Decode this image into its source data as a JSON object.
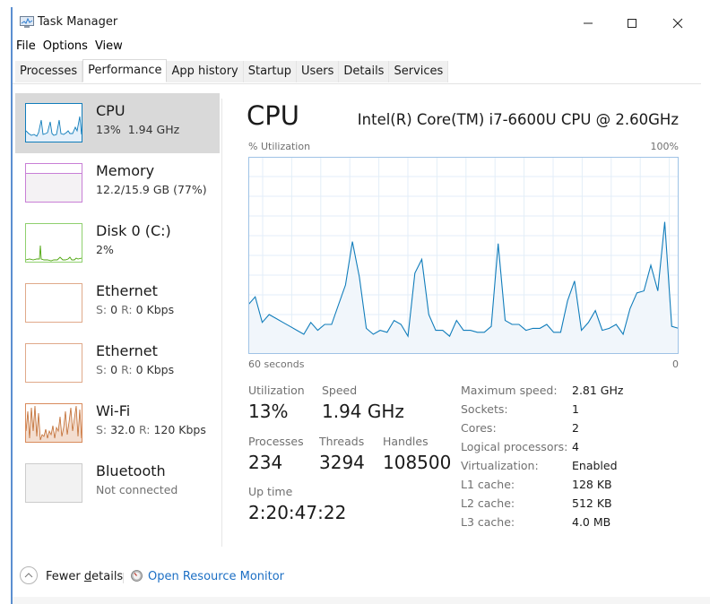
{
  "window": {
    "title": "Task Manager",
    "controls": {
      "minimize": "minimize-icon",
      "maximize": "maximize-icon",
      "close": "close-icon"
    }
  },
  "menu": [
    "File",
    "Options",
    "View"
  ],
  "tabs": [
    {
      "label": "Processes",
      "active": false
    },
    {
      "label": "Performance",
      "active": true
    },
    {
      "label": "App history",
      "active": false
    },
    {
      "label": "Startup",
      "active": false
    },
    {
      "label": "Users",
      "active": false
    },
    {
      "label": "Details",
      "active": false
    },
    {
      "label": "Services",
      "active": false
    }
  ],
  "sidebar": [
    {
      "name": "CPU",
      "sub": "13%  1.94 GHz",
      "color": "#117dbb",
      "selected": true
    },
    {
      "name": "Memory",
      "sub": "12.2/15.9 GB (77%)",
      "color": "#8b12ae",
      "selected": false
    },
    {
      "name": "Disk 0 (C:)",
      "sub": "2%",
      "color": "#4da60c",
      "selected": false
    },
    {
      "name": "Ethernet",
      "sub_s": "S:",
      "sub_s_val": "0",
      "sub_r": "R:",
      "sub_r_val": "0 Kbps",
      "color": "#a74f01",
      "selected": false
    },
    {
      "name": "Ethernet",
      "sub_s": "S:",
      "sub_s_val": "0",
      "sub_r": "R:",
      "sub_r_val": "0 Kbps",
      "color": "#a74f01",
      "selected": false
    },
    {
      "name": "Wi-Fi",
      "sub_s": "S:",
      "sub_s_val": "32.0",
      "sub_r": "R:",
      "sub_r_val": "120 Kbps",
      "color": "#a74f01",
      "selected": false
    },
    {
      "name": "Bluetooth",
      "sub": "Not connected",
      "color": "#999999",
      "selected": false
    }
  ],
  "main": {
    "title": "CPU",
    "model": "Intel(R) Core(TM) i7-6600U CPU @ 2.60GHz",
    "graph": {
      "y_label": "% Utilization",
      "y_max_label": "100%",
      "x_left_label": "60 seconds",
      "x_right_label": "0",
      "line_color": "#117dbb",
      "values": [
        25,
        29,
        16,
        20,
        18,
        16,
        14,
        12,
        10,
        16,
        12,
        15,
        15,
        25,
        35,
        57,
        39,
        13,
        10,
        12,
        11,
        17,
        15,
        9,
        41,
        48,
        20,
        12,
        12,
        9,
        17,
        12,
        12,
        11,
        11,
        14,
        56,
        17,
        15,
        15,
        12,
        13,
        13,
        15,
        11,
        11,
        27,
        37,
        12,
        16,
        22,
        12,
        13,
        15,
        10,
        23,
        31,
        32,
        45,
        32,
        67,
        14,
        13
      ]
    },
    "stats": {
      "utilization": {
        "label": "Utilization",
        "value": "13%"
      },
      "speed": {
        "label": "Speed",
        "value": "1.94 GHz"
      },
      "processes": {
        "label": "Processes",
        "value": "234"
      },
      "threads": {
        "label": "Threads",
        "value": "3294"
      },
      "handles": {
        "label": "Handles",
        "value": "108500"
      },
      "uptime": {
        "label": "Up time",
        "value": "2:20:47:22"
      }
    },
    "details": [
      {
        "label": "Maximum speed:",
        "value": "2.81 GHz"
      },
      {
        "label": "Sockets:",
        "value": "1"
      },
      {
        "label": "Cores:",
        "value": "2"
      },
      {
        "label": "Logical processors:",
        "value": "4"
      },
      {
        "label": "Virtualization:",
        "value": "Enabled"
      },
      {
        "label": "L1 cache:",
        "value": "128 KB"
      },
      {
        "label": "L2 cache:",
        "value": "512 KB"
      },
      {
        "label": "L3 cache:",
        "value": "4.0 MB"
      }
    ]
  },
  "footer": {
    "fewer_details": "Fewer details",
    "fewer_details_accesskey": "d",
    "resource_monitor": "Open Resource Monitor"
  }
}
